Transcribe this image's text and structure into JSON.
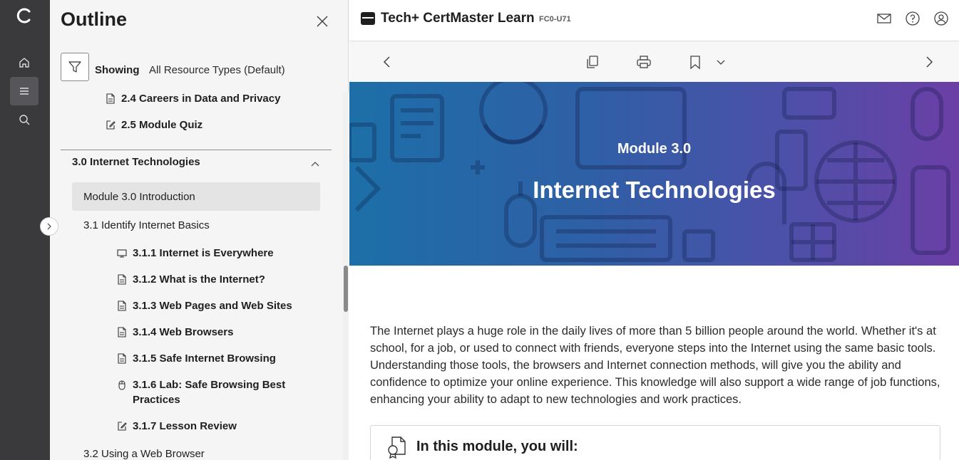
{
  "rail": {
    "items": [
      {
        "name": "home"
      },
      {
        "name": "outline",
        "active": true
      },
      {
        "name": "search"
      }
    ]
  },
  "outline": {
    "title": "Outline",
    "filter": {
      "label": "Showing",
      "value": "All Resource Types (Default)"
    },
    "prev_items": [
      {
        "label": "2.4 Careers in Data and Privacy",
        "icon": "document-icon"
      },
      {
        "label": "2.5 Module Quiz",
        "icon": "edit-icon"
      }
    ],
    "section": {
      "title": "3.0 Internet Technologies",
      "intro": "Module 3.0 Introduction",
      "lesson": "3.1 Identify Internet Basics",
      "lesson_items": [
        {
          "label": "3.1.1 Internet is Everywhere",
          "icon": "monitor-icon"
        },
        {
          "label": "3.1.2 What is the Internet?",
          "icon": "document-icon"
        },
        {
          "label": "3.1.3 Web Pages and Web Sites",
          "icon": "document-icon"
        },
        {
          "label": "3.1.4 Web Browsers",
          "icon": "document-icon"
        },
        {
          "label": "3.1.5 Safe Internet Browsing",
          "icon": "document-icon"
        },
        {
          "label_line1": "3.1.6 Lab: Safe Browsing Best",
          "label_line2": "Practices",
          "icon": "mouse-icon"
        },
        {
          "label": "3.1.7 Lesson Review",
          "icon": "edit-icon"
        }
      ],
      "next_lesson": "3.2 Using a Web Browser"
    }
  },
  "header": {
    "title": "Tech+ CertMaster Learn",
    "code": "FC0-U71"
  },
  "banner": {
    "subtitle": "Module 3.0",
    "title": "Internet Technologies"
  },
  "content": {
    "intro_paragraph": "The Internet plays a huge role in the daily lives of more than 5 billion people around the world. Whether it's at school, for a job, or used to connect with friends, everyone steps into the Internet using the same basic tools. Understanding those tools, the browsers and Internet connection methods, will give you the ability and confidence to optimize your online experience. This knowledge will also support a wide range of job functions, enhancing your ability to adapt to new technologies and work practices.",
    "module_box_title": "In this module, you will:"
  },
  "colors": {
    "rail": "#3a3a3d",
    "panel": "#f5f5f5",
    "banner_start": "#1d6fa8",
    "banner_end": "#6b3fa6"
  }
}
